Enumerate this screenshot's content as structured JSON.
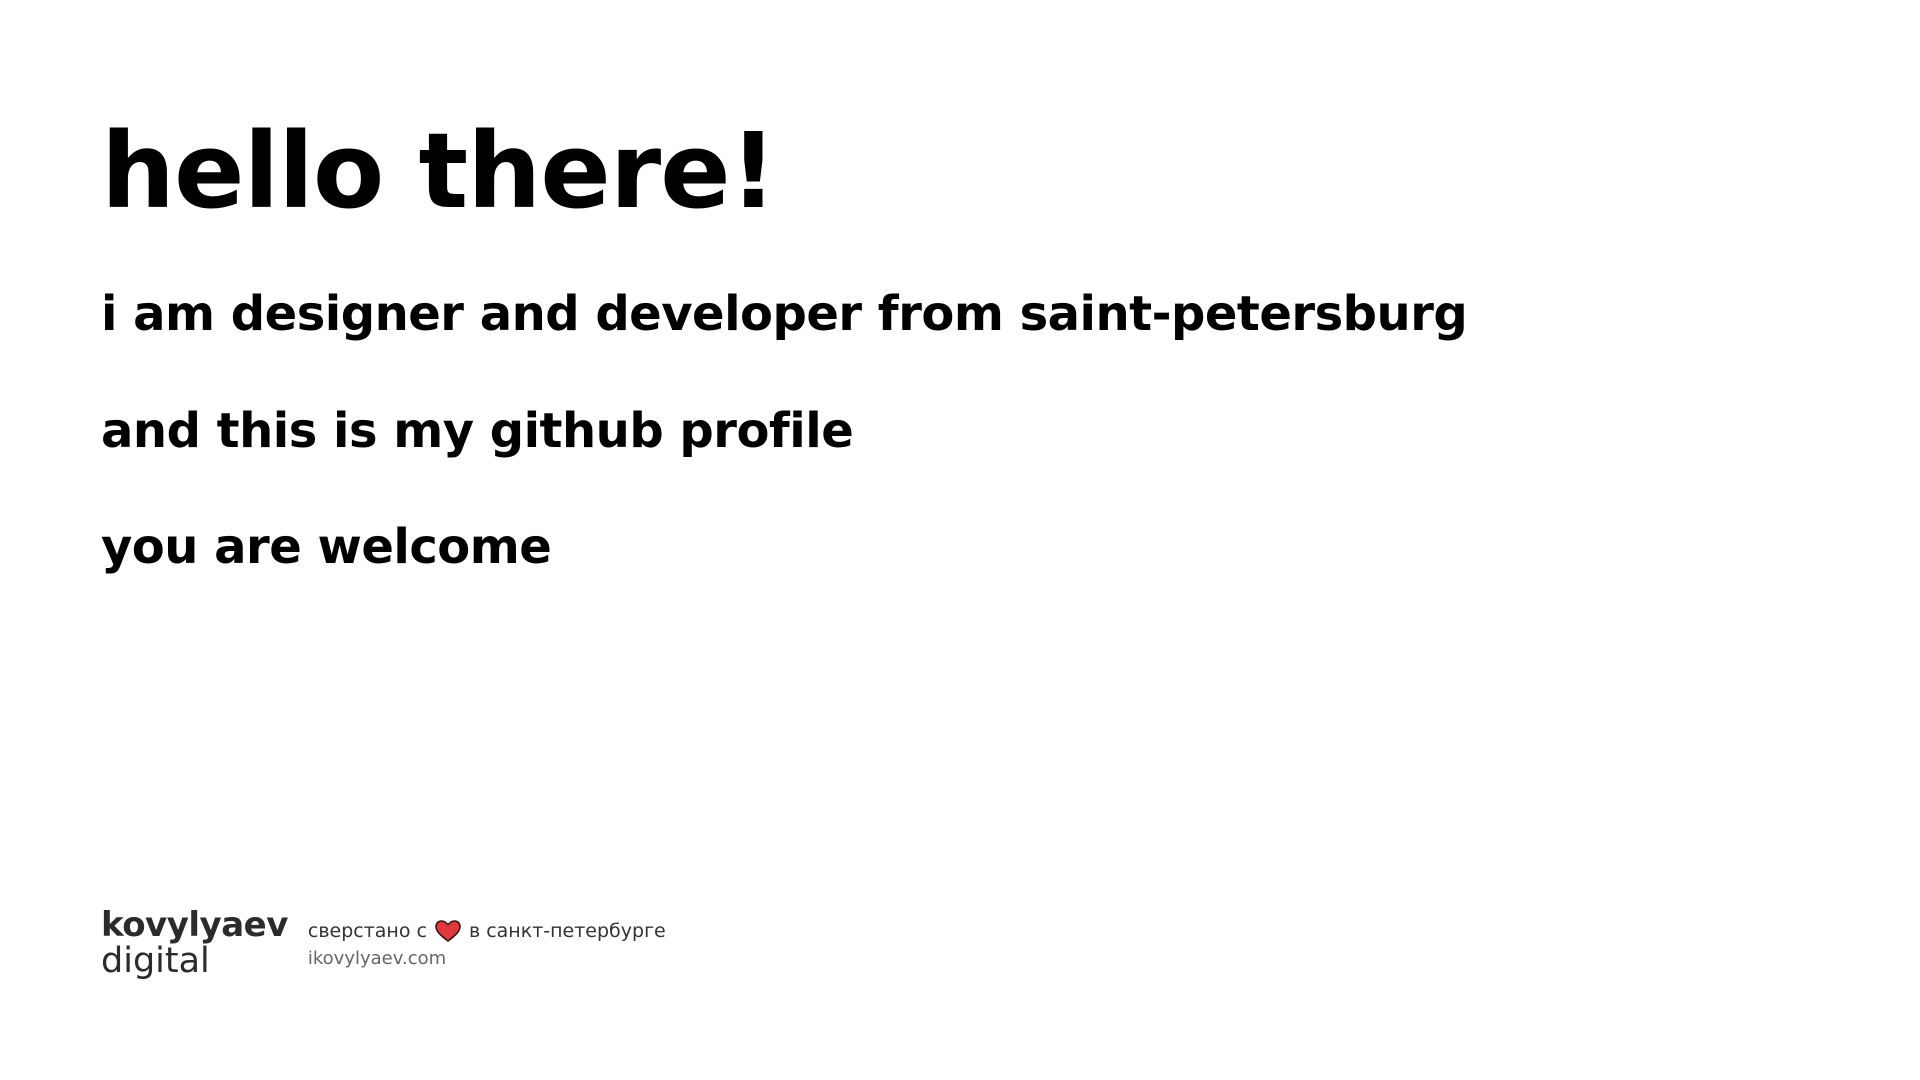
{
  "main": {
    "headline": "hello there!",
    "lines": [
      "i am designer and developer from saint-petersburg",
      "and this is my github profile",
      "you are welcome"
    ]
  },
  "footer": {
    "brand_top": "kovylyaev",
    "brand_bottom": "digital",
    "credits_before": "сверстано с",
    "credits_after": "в санкт-петербурге",
    "heart_icon": "heart-icon",
    "heart_color": "#e03a3e",
    "site": "ikovylyaev.com"
  }
}
